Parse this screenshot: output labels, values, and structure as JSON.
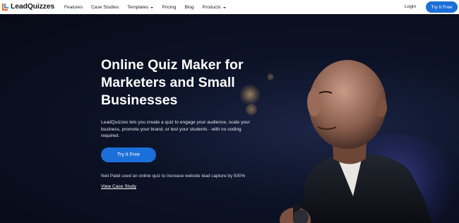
{
  "brand": {
    "name": "LeadQuizzes",
    "accent": "#1b6fd9"
  },
  "nav": {
    "items": [
      {
        "label": "Features",
        "dropdown": false
      },
      {
        "label": "Case Studies",
        "dropdown": false
      },
      {
        "label": "Templates",
        "dropdown": true
      },
      {
        "label": "Pricing",
        "dropdown": false
      },
      {
        "label": "Blog",
        "dropdown": false
      },
      {
        "label": "Products",
        "dropdown": true
      }
    ],
    "login_label": "Login",
    "cta_label": "Try It Free"
  },
  "hero": {
    "headline": "Online Quiz Maker for Marketers and Small Businesses",
    "subtext": "LeadQuizzes lets you create a quiz to engage your audience, scale your business, promote your brand, or test your students - with no coding required.",
    "cta_label": "Try It Free",
    "proof_text": "Neil Patel used an online quiz to increase website lead capture by 500%",
    "case_link": "View Case Study"
  }
}
